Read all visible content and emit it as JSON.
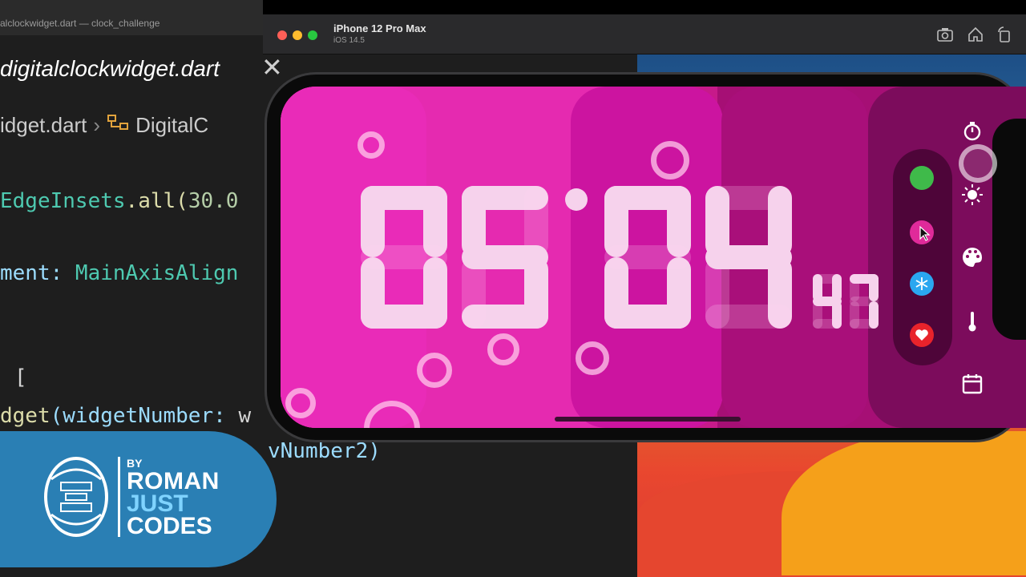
{
  "editor": {
    "window_title": "alclockwidget.dart — clock_challenge",
    "tab_label": "digitalclockwidget.dart",
    "breadcrumb": {
      "file": "idget.dart",
      "symbol": "DigitalC"
    },
    "code_lines": {
      "l1_type": "EdgeInsets",
      "l1_fn": ".all(",
      "l1_num": "30.0",
      "l2_prop": "ment: ",
      "l2_type": "MainAxisAlign",
      "l3_plain": "[",
      "l4_fn": "dget",
      "l4_plain": "(widgetNumber: ",
      "l4_tail": "w",
      "l5_plain": "vNumber2)"
    }
  },
  "simulator": {
    "device": "iPhone 12 Pro Max",
    "os": "iOS 14.5",
    "toolbar_icons": [
      "screenshot-icon",
      "home-icon",
      "rotate-icon"
    ]
  },
  "clock": {
    "hours": "05",
    "minutes": "04",
    "seconds": "47"
  },
  "color_options": [
    "green",
    "pink",
    "blue",
    "red"
  ],
  "selected_color": "pink",
  "colors": {
    "green": "#3fba4a",
    "pink": "#e02a9a",
    "blue": "#2aa7f0",
    "red": "#e8232b"
  },
  "side_icons": [
    "timer-icon",
    "brightness-icon",
    "palette-icon",
    "thermometer-icon",
    "calendar-icon"
  ],
  "brand": {
    "by": "BY",
    "line1": "ROMAN",
    "line2": "JUST",
    "line3": "CODES"
  }
}
